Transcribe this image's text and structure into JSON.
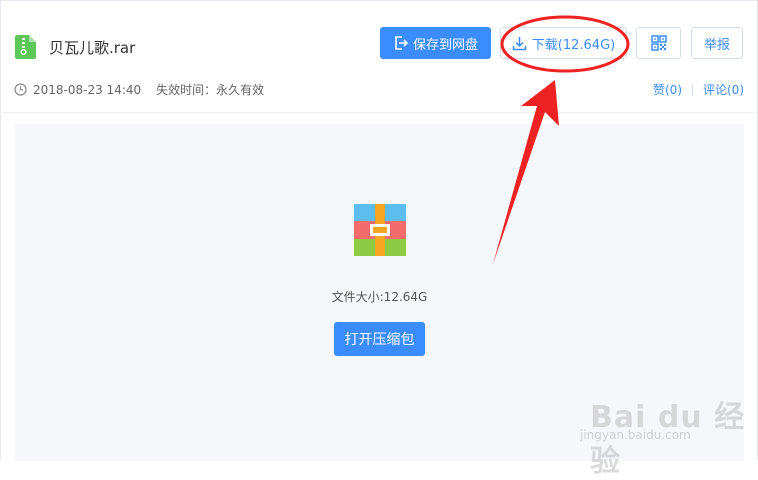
{
  "file": {
    "name": "贝瓦儿歌.rar",
    "icon": "zip-file-icon",
    "icon_color": "#5cc85a"
  },
  "toolbar": {
    "save_label": "保存到网盘",
    "download_label": "下载(12.64G)",
    "report_label": "举报",
    "qr_icon": "qr-code-icon"
  },
  "meta": {
    "date": "2018-08-23 14:40",
    "expiry": "失效时间：永久有效",
    "like": "赞(0)",
    "comment": "评论(0)"
  },
  "preview": {
    "file_size": "文件大小:12.64G",
    "open_label": "打开压缩包",
    "icon": "archive-package-icon"
  },
  "annotation": {
    "color": "#ee2222"
  },
  "watermark": {
    "brand": "Bai du 经验",
    "url": "jingyan.baidu.com"
  },
  "colors": {
    "accent": "#3b8cff",
    "preview_bg": "#f5f7fb"
  }
}
